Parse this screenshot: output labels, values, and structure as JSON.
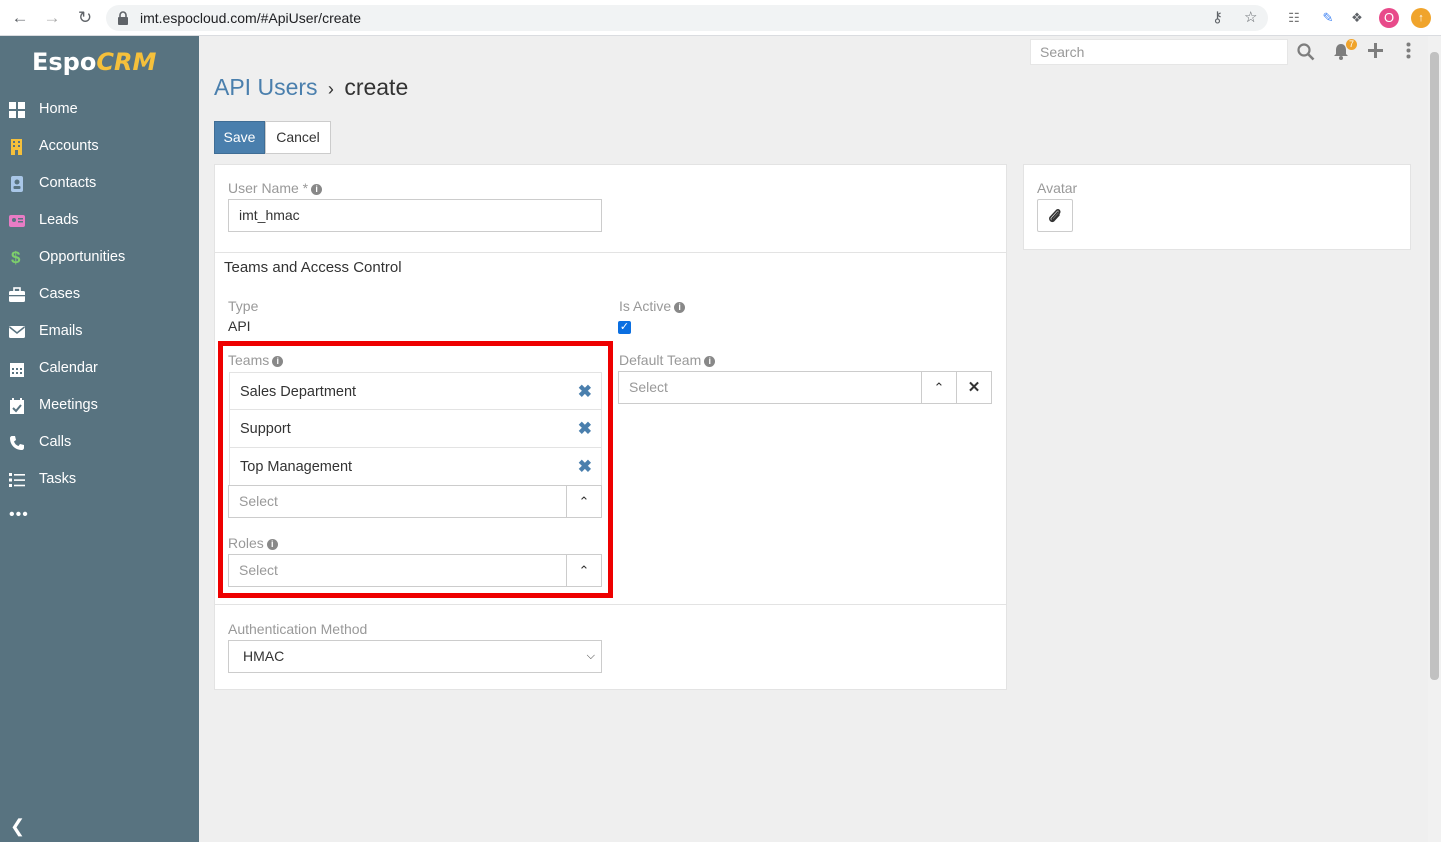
{
  "browser": {
    "url": "imt.espocloud.com/#ApiUser/create",
    "profile_initial": "O"
  },
  "sidebar": {
    "logo_main": "Espo",
    "logo_accent": "CRM",
    "items": [
      {
        "label": "Home",
        "icon": "home-icon"
      },
      {
        "label": "Accounts",
        "icon": "building-icon"
      },
      {
        "label": "Contacts",
        "icon": "contact-card-icon"
      },
      {
        "label": "Leads",
        "icon": "id-card-icon"
      },
      {
        "label": "Opportunities",
        "icon": "dollar-icon"
      },
      {
        "label": "Cases",
        "icon": "briefcase-icon"
      },
      {
        "label": "Emails",
        "icon": "envelope-icon"
      },
      {
        "label": "Calendar",
        "icon": "calendar-icon"
      },
      {
        "label": "Meetings",
        "icon": "calendar-check-icon"
      },
      {
        "label": "Calls",
        "icon": "phone-icon"
      },
      {
        "label": "Tasks",
        "icon": "tasks-icon"
      }
    ],
    "colors": {
      "background": "#587380",
      "logo_accent": "#f5c03b"
    }
  },
  "header": {
    "search_placeholder": "Search",
    "notification_count": "7"
  },
  "page": {
    "breadcrumb_parent": "API Users",
    "breadcrumb_separator": "›",
    "breadcrumb_current": "create",
    "save_label": "Save",
    "cancel_label": "Cancel"
  },
  "form": {
    "user_name_label": "User Name *",
    "user_name_value": "imt_hmac",
    "section_title": "Teams and Access Control",
    "type_label": "Type",
    "type_value": "API",
    "is_active_label": "Is Active",
    "is_active": true,
    "teams_label": "Teams",
    "teams": [
      "Sales Department",
      "Support",
      "Top Management"
    ],
    "teams_select_placeholder": "Select",
    "default_team_label": "Default Team",
    "default_team_placeholder": "Select",
    "roles_label": "Roles",
    "roles_placeholder": "Select",
    "auth_method_label": "Authentication Method",
    "auth_method_value": "HMAC",
    "avatar_label": "Avatar"
  },
  "colors": {
    "primary": "#4a7fad",
    "highlight_box": "#ee0000"
  }
}
